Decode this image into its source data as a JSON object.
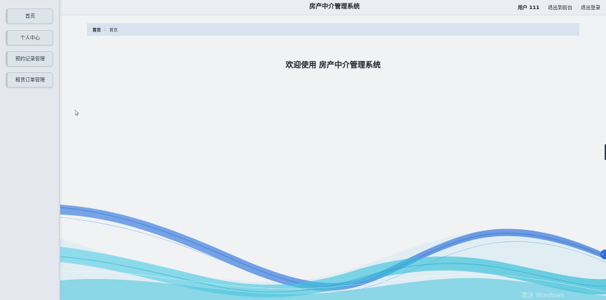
{
  "header": {
    "title": "房产中介管理系统",
    "user": "用户 111",
    "to_frontend": "退出到前台",
    "logout": "退出登录"
  },
  "sidebar": {
    "items": [
      {
        "label": "首页"
      },
      {
        "label": "个人中心"
      },
      {
        "label": "预约记录管理"
      },
      {
        "label": "租赁订单管理"
      }
    ]
  },
  "breadcrumb": {
    "root": "首页",
    "separator": "⁝",
    "current": "首页"
  },
  "main": {
    "welcome": "欢迎使用 房产中介管理系统"
  },
  "watermark": "激活 Windows",
  "icons": {
    "back_to_top": "chevron-left-icon",
    "cursor": "mouse-cursor-icon"
  },
  "colors": {
    "accent_blue": "#2f6fd6",
    "wave_cyan": "#3ec0d8",
    "breadcrumb_bg": "#d9e2ef"
  }
}
